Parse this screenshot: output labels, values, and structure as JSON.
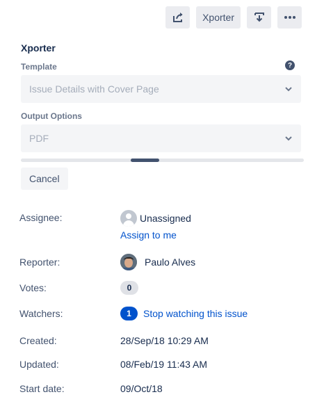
{
  "toolbar": {
    "xporter_label": "Xporter",
    "share_icon": "share-icon",
    "export_icon": "download-icon",
    "more_icon": "more-icon"
  },
  "xporter_panel": {
    "title": "Xporter",
    "template": {
      "label": "Template",
      "value": "Issue Details with Cover Page"
    },
    "output_options": {
      "label": "Output Options",
      "value": "PDF"
    },
    "cancel_label": "Cancel"
  },
  "people": {
    "assignee": {
      "label": "Assignee:",
      "value": "Unassigned",
      "assign_link": "Assign to me"
    },
    "reporter": {
      "label": "Reporter:",
      "value": "Paulo Alves"
    },
    "votes": {
      "label": "Votes:",
      "count": "0"
    },
    "watchers": {
      "label": "Watchers:",
      "count": "1",
      "action": "Stop watching this issue"
    }
  },
  "dates": {
    "created": {
      "label": "Created:",
      "value": "28/Sep/18 10:29 AM"
    },
    "updated": {
      "label": "Updated:",
      "value": "08/Feb/19 11:43 AM"
    },
    "start_date": {
      "label": "Start date:",
      "value": "09/Oct/18"
    }
  },
  "colors": {
    "link": "#0052cc",
    "button_bg": "#ebecf0",
    "field_bg": "#f4f5f7"
  }
}
